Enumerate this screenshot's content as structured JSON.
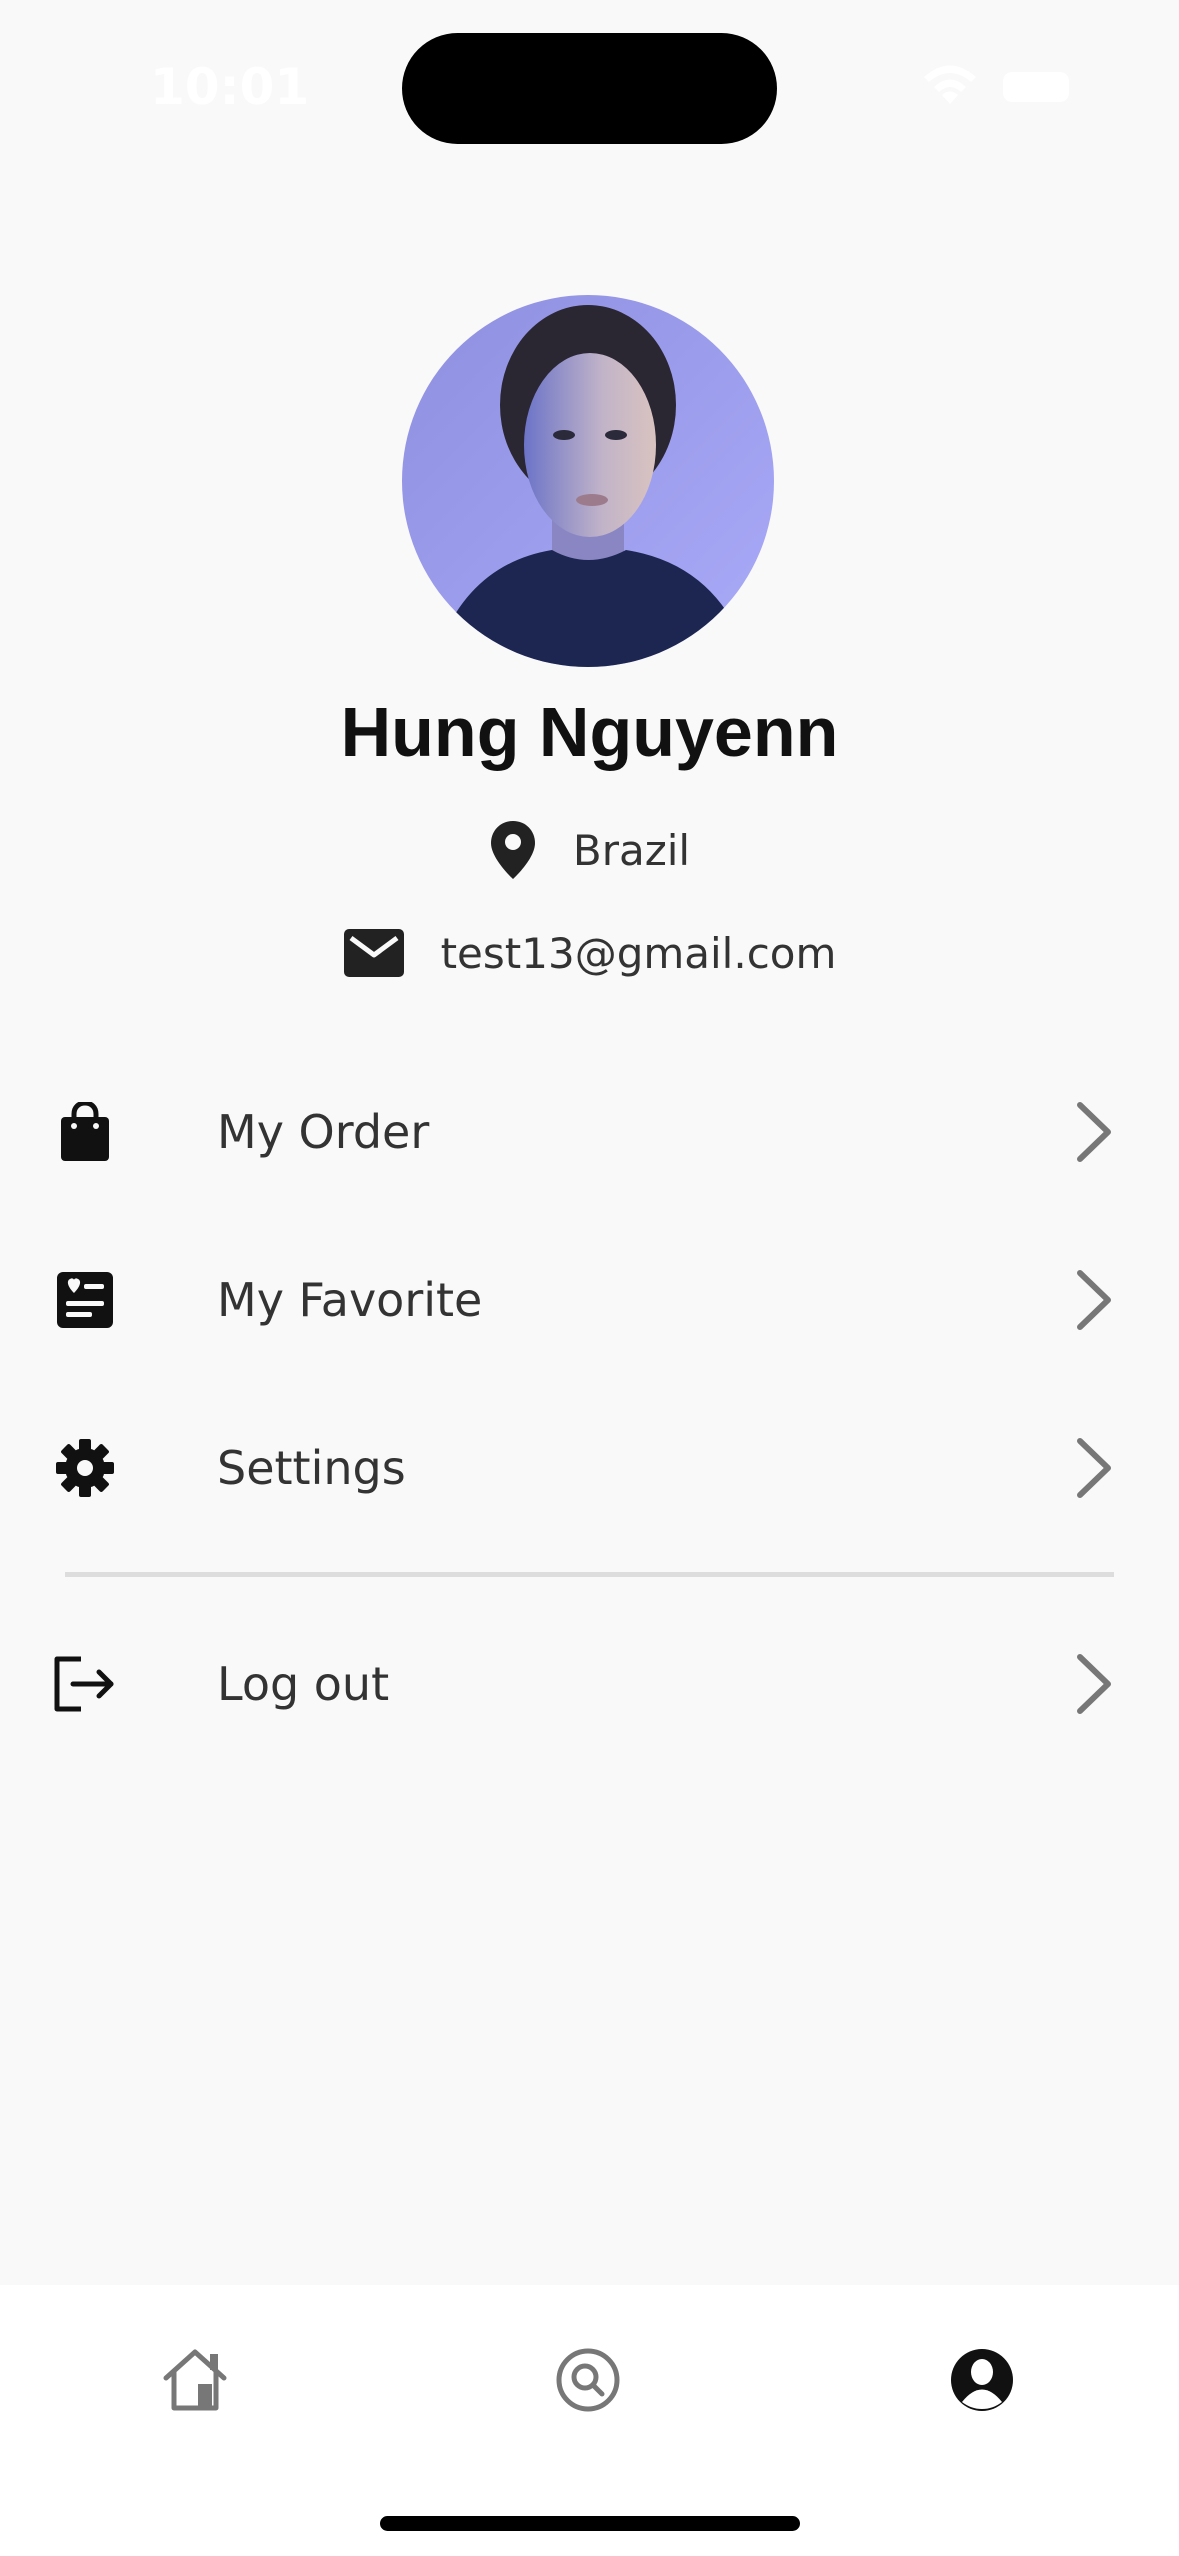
{
  "status_bar": {
    "time": "10:01"
  },
  "profile": {
    "name": "Hung Nguyenn",
    "location": "Brazil",
    "email": "test13@gmail.com"
  },
  "menu": {
    "items": [
      {
        "label": "My Order",
        "icon": "shopping-bag-icon"
      },
      {
        "label": "My Favorite",
        "icon": "favorite-list-icon"
      },
      {
        "label": "Settings",
        "icon": "gear-icon"
      },
      {
        "label": "Log out",
        "icon": "logout-icon"
      }
    ]
  },
  "tab_bar": {
    "tabs": [
      {
        "icon": "home-icon",
        "active": false
      },
      {
        "icon": "search-icon",
        "active": false
      },
      {
        "icon": "profile-icon",
        "active": true
      }
    ]
  },
  "colors": {
    "background": "#f9f9f9",
    "text": "#222222",
    "tab_bar_bg": "#ffffff",
    "inactive_tab": "#777777",
    "chevron": "#777777",
    "avatar_bg": "#9a9cf0"
  }
}
